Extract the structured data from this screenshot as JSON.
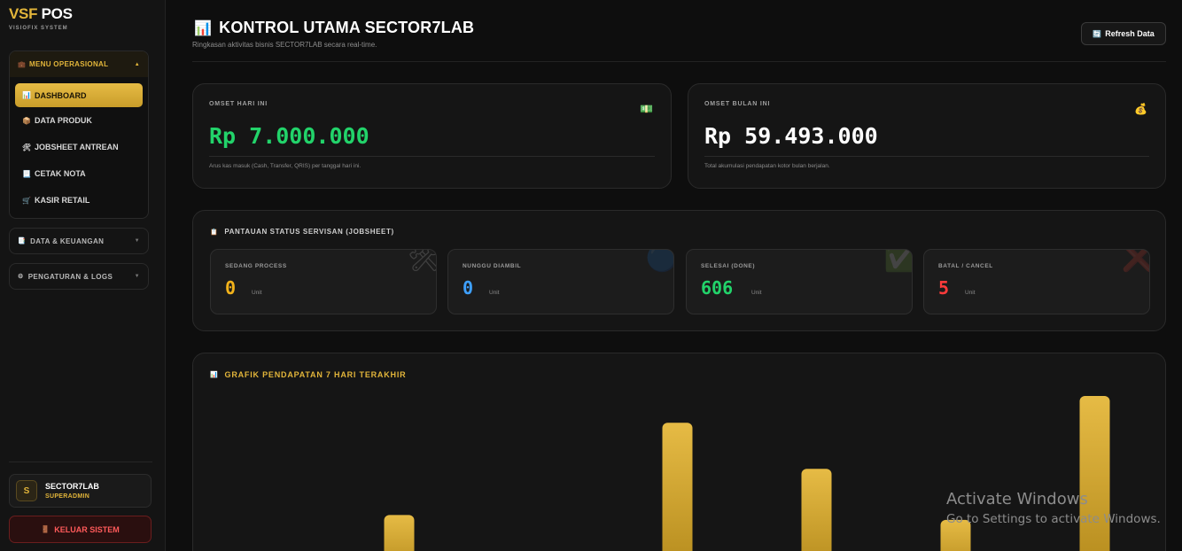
{
  "brand": {
    "title_gold": "VSF",
    "title_rest": "POS",
    "subtitle": "VISIOFIX SYSTEM"
  },
  "sidebar": {
    "menu_operasional": {
      "label": "MENU OPERASIONAL",
      "icon": "briefcase-icon",
      "items": [
        {
          "label": "DASHBOARD",
          "icon": "chart-icon",
          "active": true
        },
        {
          "label": "DATA PRODUK",
          "icon": "box-icon"
        },
        {
          "label": "JOBSHEET ANTREAN",
          "icon": "tools-icon"
        },
        {
          "label": "CETAK NOTA",
          "icon": "receipt-icon"
        },
        {
          "label": "KASIR RETAIL",
          "icon": "cart-icon"
        }
      ]
    },
    "data_keuangan": {
      "label": "DATA & KEUANGAN",
      "icon": "finance-icon"
    },
    "pengaturan": {
      "label": "PENGATURAN & LOGS",
      "icon": "gear-icon"
    },
    "user": {
      "initial": "S",
      "name": "SECTOR7LAB",
      "role": "SUPERADMIN"
    },
    "logout_label": "KELUAR SISTEM"
  },
  "header": {
    "title": "KONTROL UTAMA SECTOR7LAB",
    "subtitle": "Ringkasan aktivitas bisnis SECTOR7LAB secara real-time.",
    "refresh_label": "Refresh Data"
  },
  "omset_hari": {
    "label": "OMSET HARI INI",
    "value": "Rp 7.000.000",
    "note": "Arus kas masuk (Cash, Transfer, QRIS) per tanggal hari ini.",
    "icon": "money-icon",
    "color": "#22d36a"
  },
  "omset_bulan": {
    "label": "OMSET BULAN INI",
    "value": "Rp 59.493.000",
    "note": "Total akumulasi pendapatan kotor bulan berjalan.",
    "icon": "money-bag-icon",
    "color": "#ffffff"
  },
  "status": {
    "title": "PANTAUAN STATUS SERVISAN (JOBSHEET)",
    "unit": "Unit",
    "items": [
      {
        "label": "SEDANG PROCESS",
        "value": "0",
        "color": "#f2b21a"
      },
      {
        "label": "NUNGGU DIAMBIL",
        "value": "0",
        "color": "#3ea0ff"
      },
      {
        "label": "SELESAI (DONE)",
        "value": "606",
        "color": "#22d36a"
      },
      {
        "label": "BATAL / CANCEL",
        "value": "5",
        "color": "#ff3b3b"
      }
    ]
  },
  "chart": {
    "title": "GRAFIK PENDAPATAN 7 HARI TERAKHIR"
  },
  "chart_data": {
    "type": "bar",
    "title": "GRAFIK PENDAPATAN 7 HARI TERAKHIR",
    "categories": [
      "",
      "",
      "",
      "",
      "",
      "",
      ""
    ],
    "values": [
      0,
      2.1,
      0,
      5.9,
      4.0,
      1.9,
      7.0
    ],
    "unit": "million Rp (estimated)",
    "ylim": [
      0,
      7.0
    ],
    "grid": false,
    "bar_color": "#e2b53a"
  },
  "watermark": {
    "line1": "Activate Windows",
    "line2": "Go to Settings to activate Windows."
  }
}
